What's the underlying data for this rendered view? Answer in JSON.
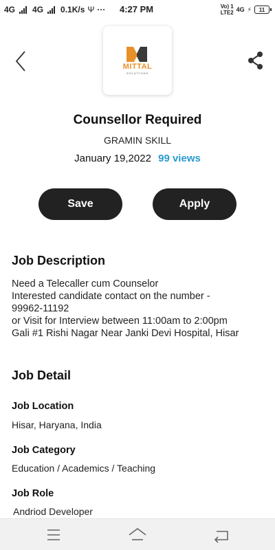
{
  "status_bar": {
    "network_1": "4G",
    "network_2": "4G",
    "speed": "0.1K/s",
    "usb": "Ψ",
    "more": "···",
    "time": "4:27 PM",
    "volte": "Vo) 1",
    "lte": "LTE2",
    "network_3": "4G",
    "battery": "11"
  },
  "header": {
    "back_icon": "chevron-left-icon",
    "share_icon": "share-icon"
  },
  "logo": {
    "word": "MITTAL",
    "sub": "SOLUTIONS",
    "colors": {
      "orange": "#e8912a",
      "dark": "#3a3a3a"
    }
  },
  "job": {
    "title": "Counsellor Required",
    "company": "GRAMIN SKILL",
    "date": "January 19,2022",
    "views": "99 views"
  },
  "actions": {
    "save_label": "Save",
    "apply_label": "Apply"
  },
  "description": {
    "heading": "Job Description",
    "lines": [
      "Need a Telecaller cum Counselor",
      "Interested candidate contact on the number -",
      "99962-11192",
      "or Visit for Interview between 11:00am to 2:00pm",
      "Gali #1 Rishi Nagar Near Janki Devi Hospital, Hisar"
    ]
  },
  "detail": {
    "heading": "Job Detail",
    "location_label": "Job Location",
    "location_value": "Hisar, Haryana, India",
    "category_label": "Job Category",
    "category_value": "Education / Academics / Teaching",
    "role_label": "Job Role",
    "role_value": "Andriod Developer"
  },
  "nav": {
    "menu_icon": "menu-icon",
    "home_icon": "home-icon",
    "back_icon": "back-arrow-icon"
  },
  "colors": {
    "accent": "#2a9bd1",
    "button": "#222222"
  }
}
